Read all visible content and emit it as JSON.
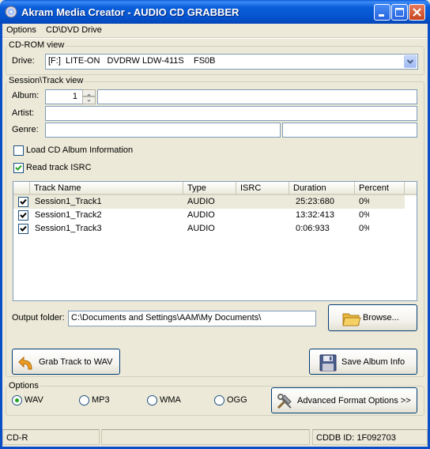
{
  "window": {
    "title": "Akram Media Creator - AUDIO CD GRABBER"
  },
  "menu": [
    {
      "label": "Options"
    },
    {
      "label": "CD\\DVD Drive"
    }
  ],
  "cdrom": {
    "group_label": "CD-ROM view",
    "drive_label": "Drive:",
    "drive_value": "[F:]  LITE-ON   DVDRW LDW-411S    FS0B"
  },
  "session": {
    "group_label": "Session\\Track view",
    "album_label": "Album:",
    "album_number": "1",
    "album_value": "",
    "artist_label": "Artist:",
    "artist_value": "",
    "genre_label": "Genre:",
    "genre_value": "",
    "genre_extra_value": "",
    "load_cd_label": "Load CD Album Information",
    "load_cd_checked": false,
    "read_isrc_label": "Read track ISRC",
    "read_isrc_checked": true
  },
  "tracks": {
    "columns": [
      "",
      "Track Name",
      "Type",
      "ISRC",
      "Duration",
      "Percent"
    ],
    "rows": [
      {
        "checked": true,
        "name": "Session1_Track1",
        "type": "AUDIO",
        "isrc": "",
        "duration": "25:23:680",
        "percent": "0%"
      },
      {
        "checked": true,
        "name": "Session1_Track2",
        "type": "AUDIO",
        "isrc": "",
        "duration": "13:32:413",
        "percent": "0%"
      },
      {
        "checked": true,
        "name": "Session1_Track3",
        "type": "AUDIO",
        "isrc": "",
        "duration": "0:06:933",
        "percent": "0%"
      }
    ]
  },
  "output": {
    "label": "Output folder:",
    "path": "C:\\Documents and Settings\\AAM\\My Documents\\",
    "browse_label": "Browse..."
  },
  "actions": {
    "grab_label": "Grab Track to WAV",
    "save_label": "Save Album Info"
  },
  "options": {
    "group_label": "Options",
    "formats": [
      {
        "label": "WAV",
        "selected": true
      },
      {
        "label": "MP3",
        "selected": false
      },
      {
        "label": "WMA",
        "selected": false
      },
      {
        "label": "OGG",
        "selected": false
      }
    ],
    "advanced_label": "Advanced Format Options >>"
  },
  "status": {
    "media": "CD-R",
    "middle": "",
    "cddb": "CDDB ID: 1F092703"
  },
  "colors": {
    "titlebar": "#0554d0",
    "window_bg": "#ece9d8",
    "selected_row": "#ebeadb",
    "radio_dot": "#21a121"
  }
}
